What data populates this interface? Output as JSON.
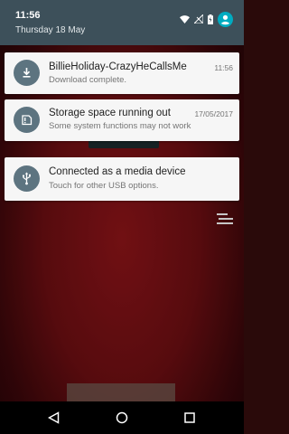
{
  "status_bar": {
    "time": "11:56",
    "date": "Thursday 18 May",
    "icons": [
      "wifi-icon",
      "signal-off-icon",
      "battery-charging-icon",
      "account-icon"
    ]
  },
  "notifications": [
    {
      "icon": "download-icon",
      "title": "BillieHoliday-CrazyHeCallsMe",
      "subtitle": "Download complete.",
      "meta": "11:56"
    },
    {
      "icon": "storage-warning-icon",
      "title": "Storage space running out",
      "subtitle": "Some system functions may not work",
      "meta": "17/05/2017"
    },
    {
      "icon": "usb-icon",
      "title": "Connected as a media device",
      "subtitle": "Touch for other USB options.",
      "meta": ""
    }
  ],
  "navbar": {
    "buttons": [
      "back-icon",
      "home-icon",
      "recents-icon"
    ]
  },
  "colors": {
    "header": "#3d505a",
    "card": "#f6f6f6",
    "icon_circle": "#5d7480",
    "accent": "#00acc1"
  }
}
